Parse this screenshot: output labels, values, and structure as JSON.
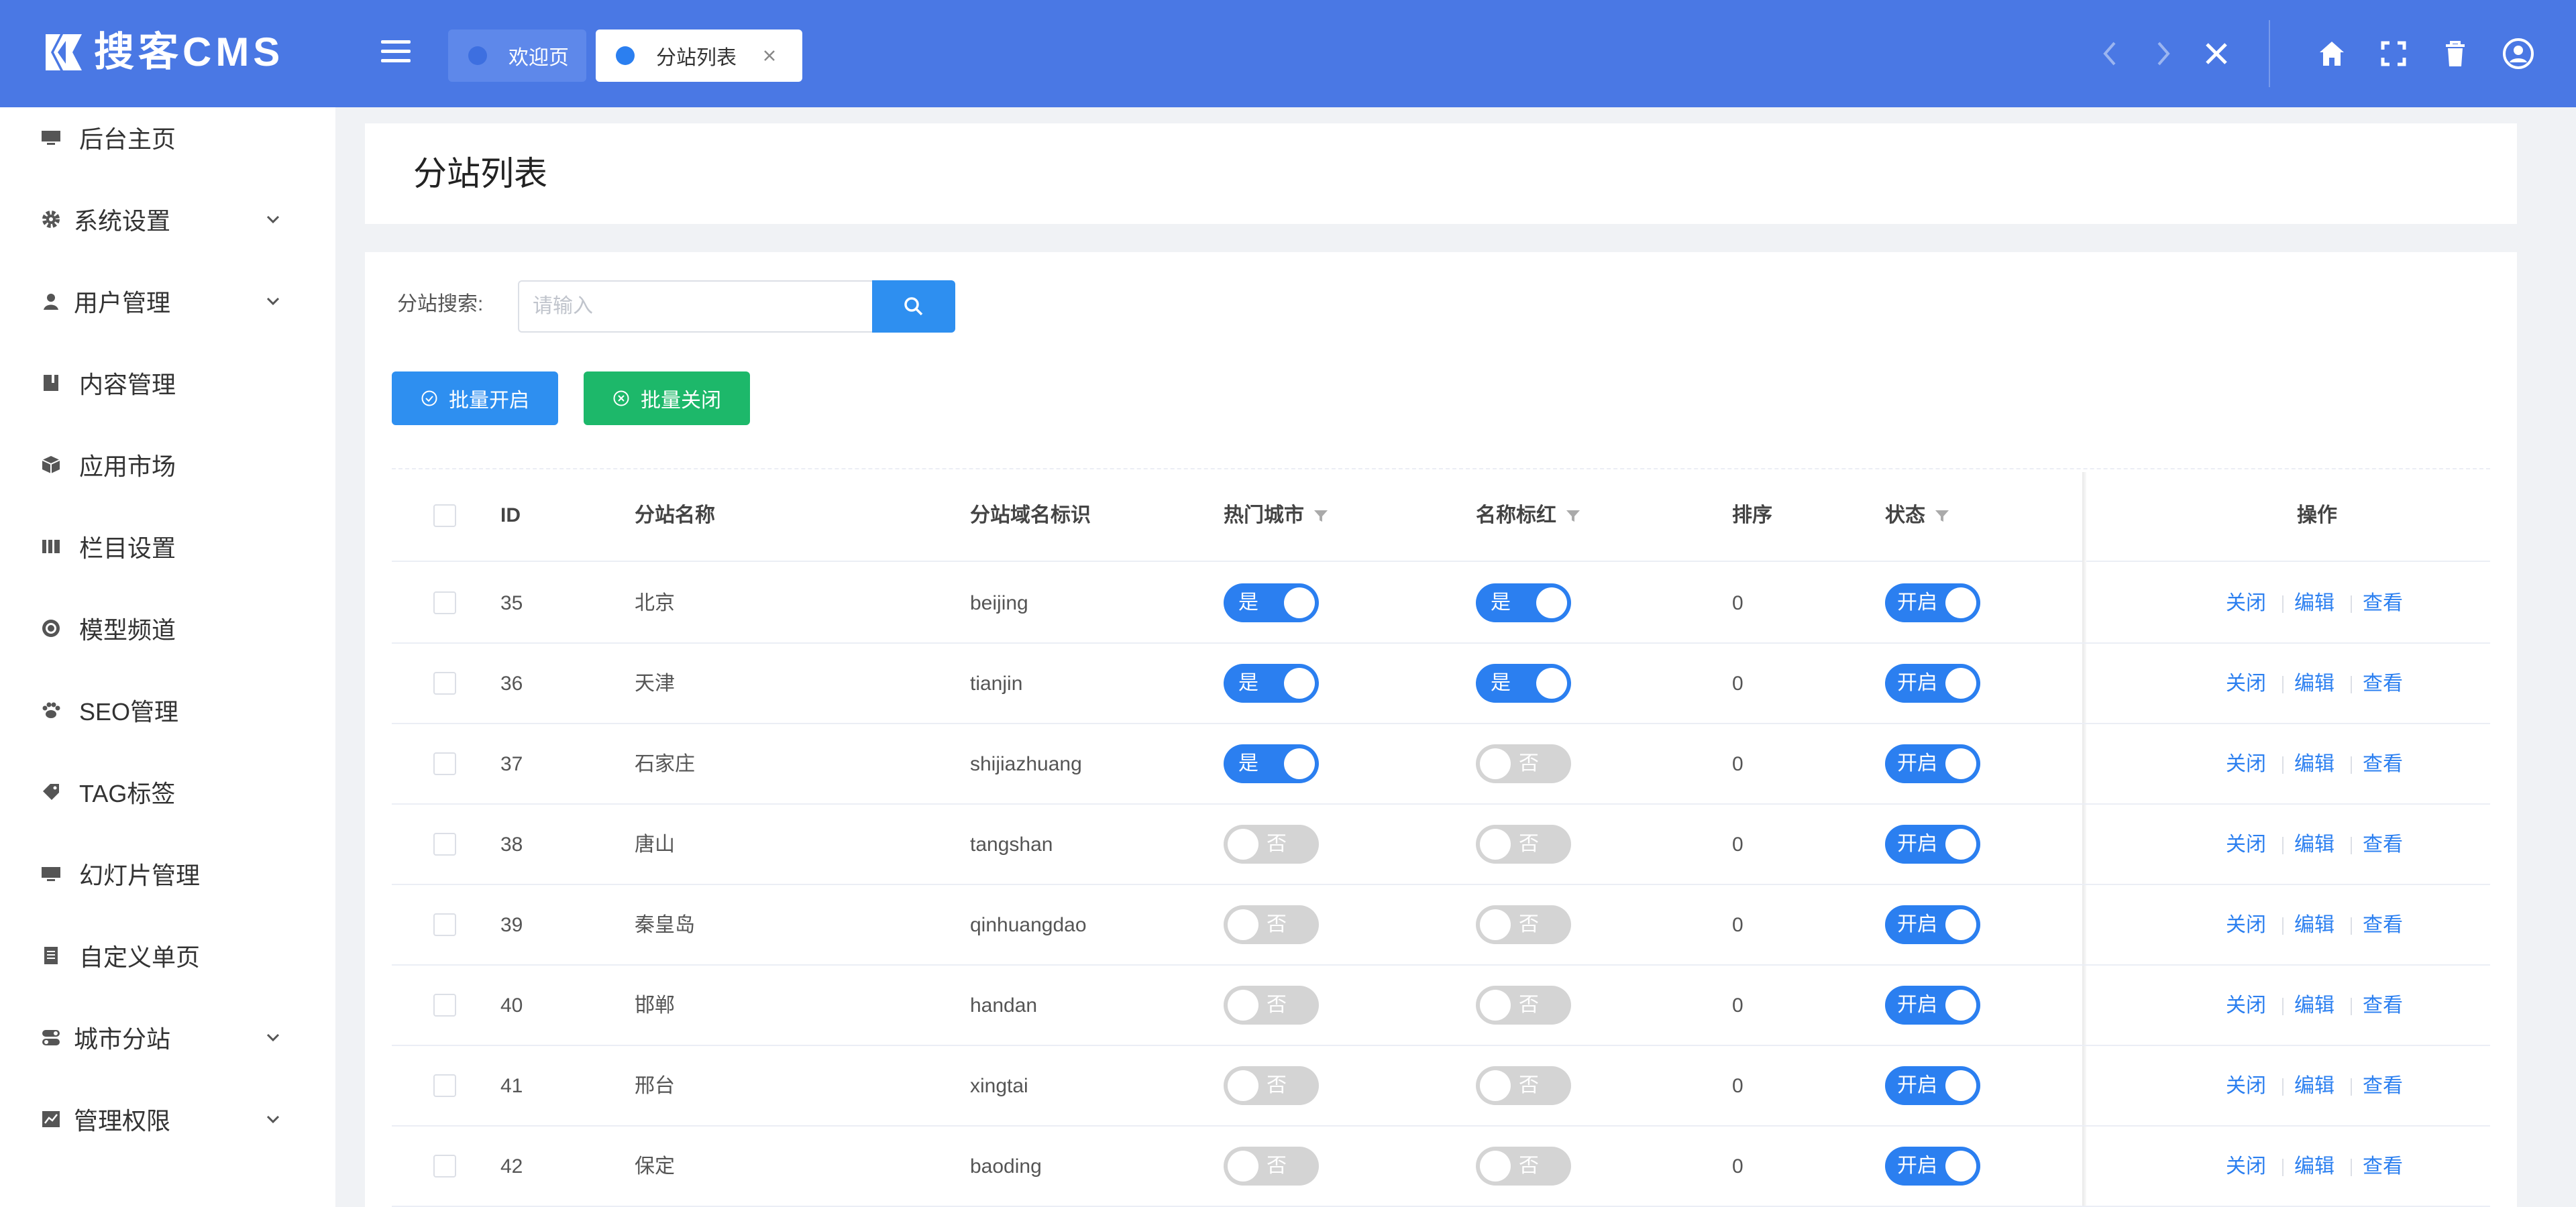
{
  "app": {
    "logo_text": "搜客CMS"
  },
  "tabs": [
    {
      "label": "欢迎页"
    },
    {
      "label": "分站列表"
    }
  ],
  "header_icons": [
    "chevron-left-icon",
    "chevron-right-icon",
    "close-icon",
    "home-icon",
    "fullscreen-icon",
    "trash-icon",
    "user-icon"
  ],
  "sidebar": {
    "items": [
      {
        "label": "后台主页",
        "icon": "monitor-icon",
        "expandable": false
      },
      {
        "label": "系统设置",
        "icon": "gear-icon",
        "expandable": true
      },
      {
        "label": "用户管理",
        "icon": "user-icon",
        "expandable": true
      },
      {
        "label": "内容管理",
        "icon": "book-icon",
        "expandable": false
      },
      {
        "label": "应用市场",
        "icon": "cube-icon",
        "expandable": false
      },
      {
        "label": "栏目设置",
        "icon": "columns-icon",
        "expandable": false
      },
      {
        "label": "模型频道",
        "icon": "target-icon",
        "expandable": false
      },
      {
        "label": "SEO管理",
        "icon": "paw-icon",
        "expandable": false
      },
      {
        "label": "TAG标签",
        "icon": "tag-icon",
        "expandable": false
      },
      {
        "label": "幻灯片管理",
        "icon": "monitor-icon",
        "expandable": false
      },
      {
        "label": "自定义单页",
        "icon": "document-icon",
        "expandable": false
      },
      {
        "label": "城市分站",
        "icon": "toggle-icon",
        "expandable": true
      },
      {
        "label": "管理权限",
        "icon": "chart-icon",
        "expandable": true
      }
    ]
  },
  "page": {
    "title": "分站列表"
  },
  "search": {
    "label": "分站搜索:",
    "placeholder": "请输入",
    "value": ""
  },
  "batch": {
    "open_label": "批量开启",
    "close_label": "批量关闭"
  },
  "table": {
    "headers": {
      "id": "ID",
      "name": "分站名称",
      "domain": "分站域名标识",
      "hot": "热门城市",
      "red": "名称标红",
      "sort": "排序",
      "status": "状态",
      "ops": "操作"
    },
    "switch_text": {
      "yes": "是",
      "no": "否",
      "open": "开启"
    },
    "op_labels": {
      "close": "关闭",
      "edit": "编辑",
      "view": "查看"
    },
    "rows": [
      {
        "id": "35",
        "name": "北京",
        "domain": "beijing",
        "hot": true,
        "red": true,
        "sort": "0",
        "status": true
      },
      {
        "id": "36",
        "name": "天津",
        "domain": "tianjin",
        "hot": true,
        "red": true,
        "sort": "0",
        "status": true
      },
      {
        "id": "37",
        "name": "石家庄",
        "domain": "shijiazhuang",
        "hot": true,
        "red": false,
        "sort": "0",
        "status": true
      },
      {
        "id": "38",
        "name": "唐山",
        "domain": "tangshan",
        "hot": false,
        "red": false,
        "sort": "0",
        "status": true
      },
      {
        "id": "39",
        "name": "秦皇岛",
        "domain": "qinhuangdao",
        "hot": false,
        "red": false,
        "sort": "0",
        "status": true
      },
      {
        "id": "40",
        "name": "邯郸",
        "domain": "handan",
        "hot": false,
        "red": false,
        "sort": "0",
        "status": true
      },
      {
        "id": "41",
        "name": "邢台",
        "domain": "xingtai",
        "hot": false,
        "red": false,
        "sort": "0",
        "status": true
      },
      {
        "id": "42",
        "name": "保定",
        "domain": "baoding",
        "hot": false,
        "red": false,
        "sort": "0",
        "status": true
      }
    ]
  },
  "colors": {
    "header_bg": "#4a78e4",
    "primary": "#2b7ff0",
    "success": "#1db86a",
    "switch_off": "#d4d4d4"
  }
}
